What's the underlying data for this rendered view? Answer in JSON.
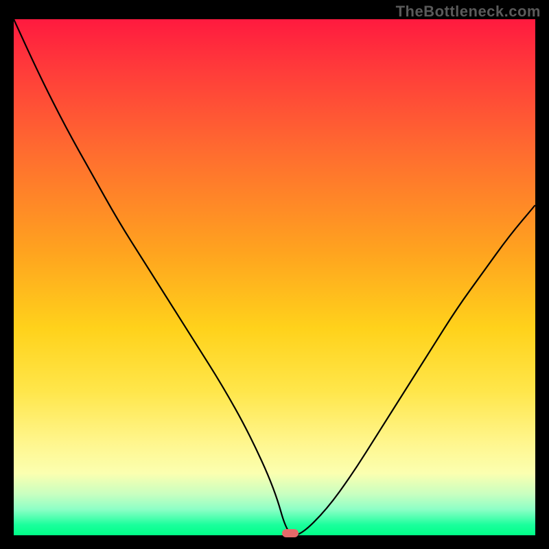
{
  "watermark": "TheBottleneck.com",
  "chart_data": {
    "type": "line",
    "title": "",
    "xlabel": "",
    "ylabel": "",
    "x": [
      0.0,
      0.05,
      0.1,
      0.15,
      0.2,
      0.25,
      0.3,
      0.35,
      0.4,
      0.45,
      0.5,
      0.525,
      0.55,
      0.6,
      0.65,
      0.7,
      0.75,
      0.8,
      0.85,
      0.9,
      0.95,
      1.0
    ],
    "values": [
      1.0,
      0.89,
      0.79,
      0.7,
      0.61,
      0.53,
      0.45,
      0.37,
      0.29,
      0.2,
      0.09,
      0.0,
      0.0,
      0.05,
      0.12,
      0.2,
      0.28,
      0.36,
      0.44,
      0.51,
      0.58,
      0.64
    ],
    "ylim": [
      0,
      1
    ],
    "xlim": [
      0,
      1
    ],
    "notch_center_x": 0.53,
    "marker": {
      "x": 0.53,
      "y": 0.0
    },
    "background_gradient": {
      "top": "#ff1a3f",
      "mid": "#ffd21b",
      "bottom": "#00ff87"
    }
  }
}
